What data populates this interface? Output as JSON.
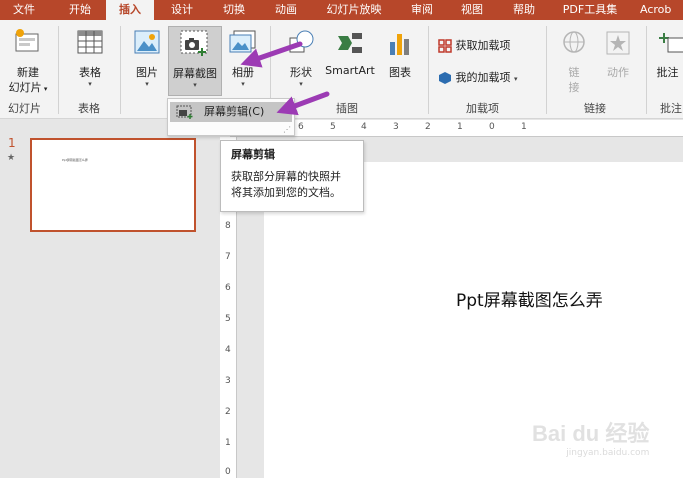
{
  "tabs": [
    "文件",
    "开始",
    "插入",
    "设计",
    "切换",
    "动画",
    "幻灯片放映",
    "审阅",
    "视图",
    "帮助",
    "PDF工具集",
    "Acrob"
  ],
  "active_tab": "插入",
  "ribbon": {
    "new_slide": {
      "line1": "新建",
      "line2": "幻灯片"
    },
    "table": "表格",
    "picture": "图片",
    "screenshot": "屏幕截图",
    "album": "相册",
    "shape": "形状",
    "smartart": "SmartArt",
    "chart": "图表",
    "get_addins": "获取加载项",
    "my_addins": "我的加载项",
    "link": {
      "line1": "链",
      "line2": "接"
    },
    "action": "动作",
    "comment": "批注",
    "groups": {
      "slides": "幻灯片",
      "tables": "表格",
      "illustrations": "插图",
      "addins": "加载项",
      "links": "链接",
      "comments": "批注"
    }
  },
  "dropdown": {
    "screen_clipping": "屏幕剪辑(C)"
  },
  "tooltip": {
    "title": "屏幕剪辑",
    "line1": "获取部分屏幕的快照并",
    "line2": "将其添加到您的文档。"
  },
  "slides_panel": {
    "number": "1",
    "star": "★",
    "thumb_text": "Ppt屏幕截图怎么弄"
  },
  "ruler_h": [
    "6",
    "5",
    "4",
    "3",
    "2",
    "1",
    "0",
    "1"
  ],
  "ruler_v": [
    "8",
    "7",
    "6",
    "5",
    "4",
    "3",
    "2",
    "1",
    "0"
  ],
  "slide": {
    "text": "Ppt屏幕截图怎么弄"
  },
  "watermark": {
    "brand": "Bai du 经验",
    "url": "jingyan.baidu.com"
  },
  "colors": {
    "accent": "#b7472a",
    "arrow": "#9c3bb4",
    "ribbon": "#f3f3f3",
    "selection": "#c5c5c5"
  }
}
